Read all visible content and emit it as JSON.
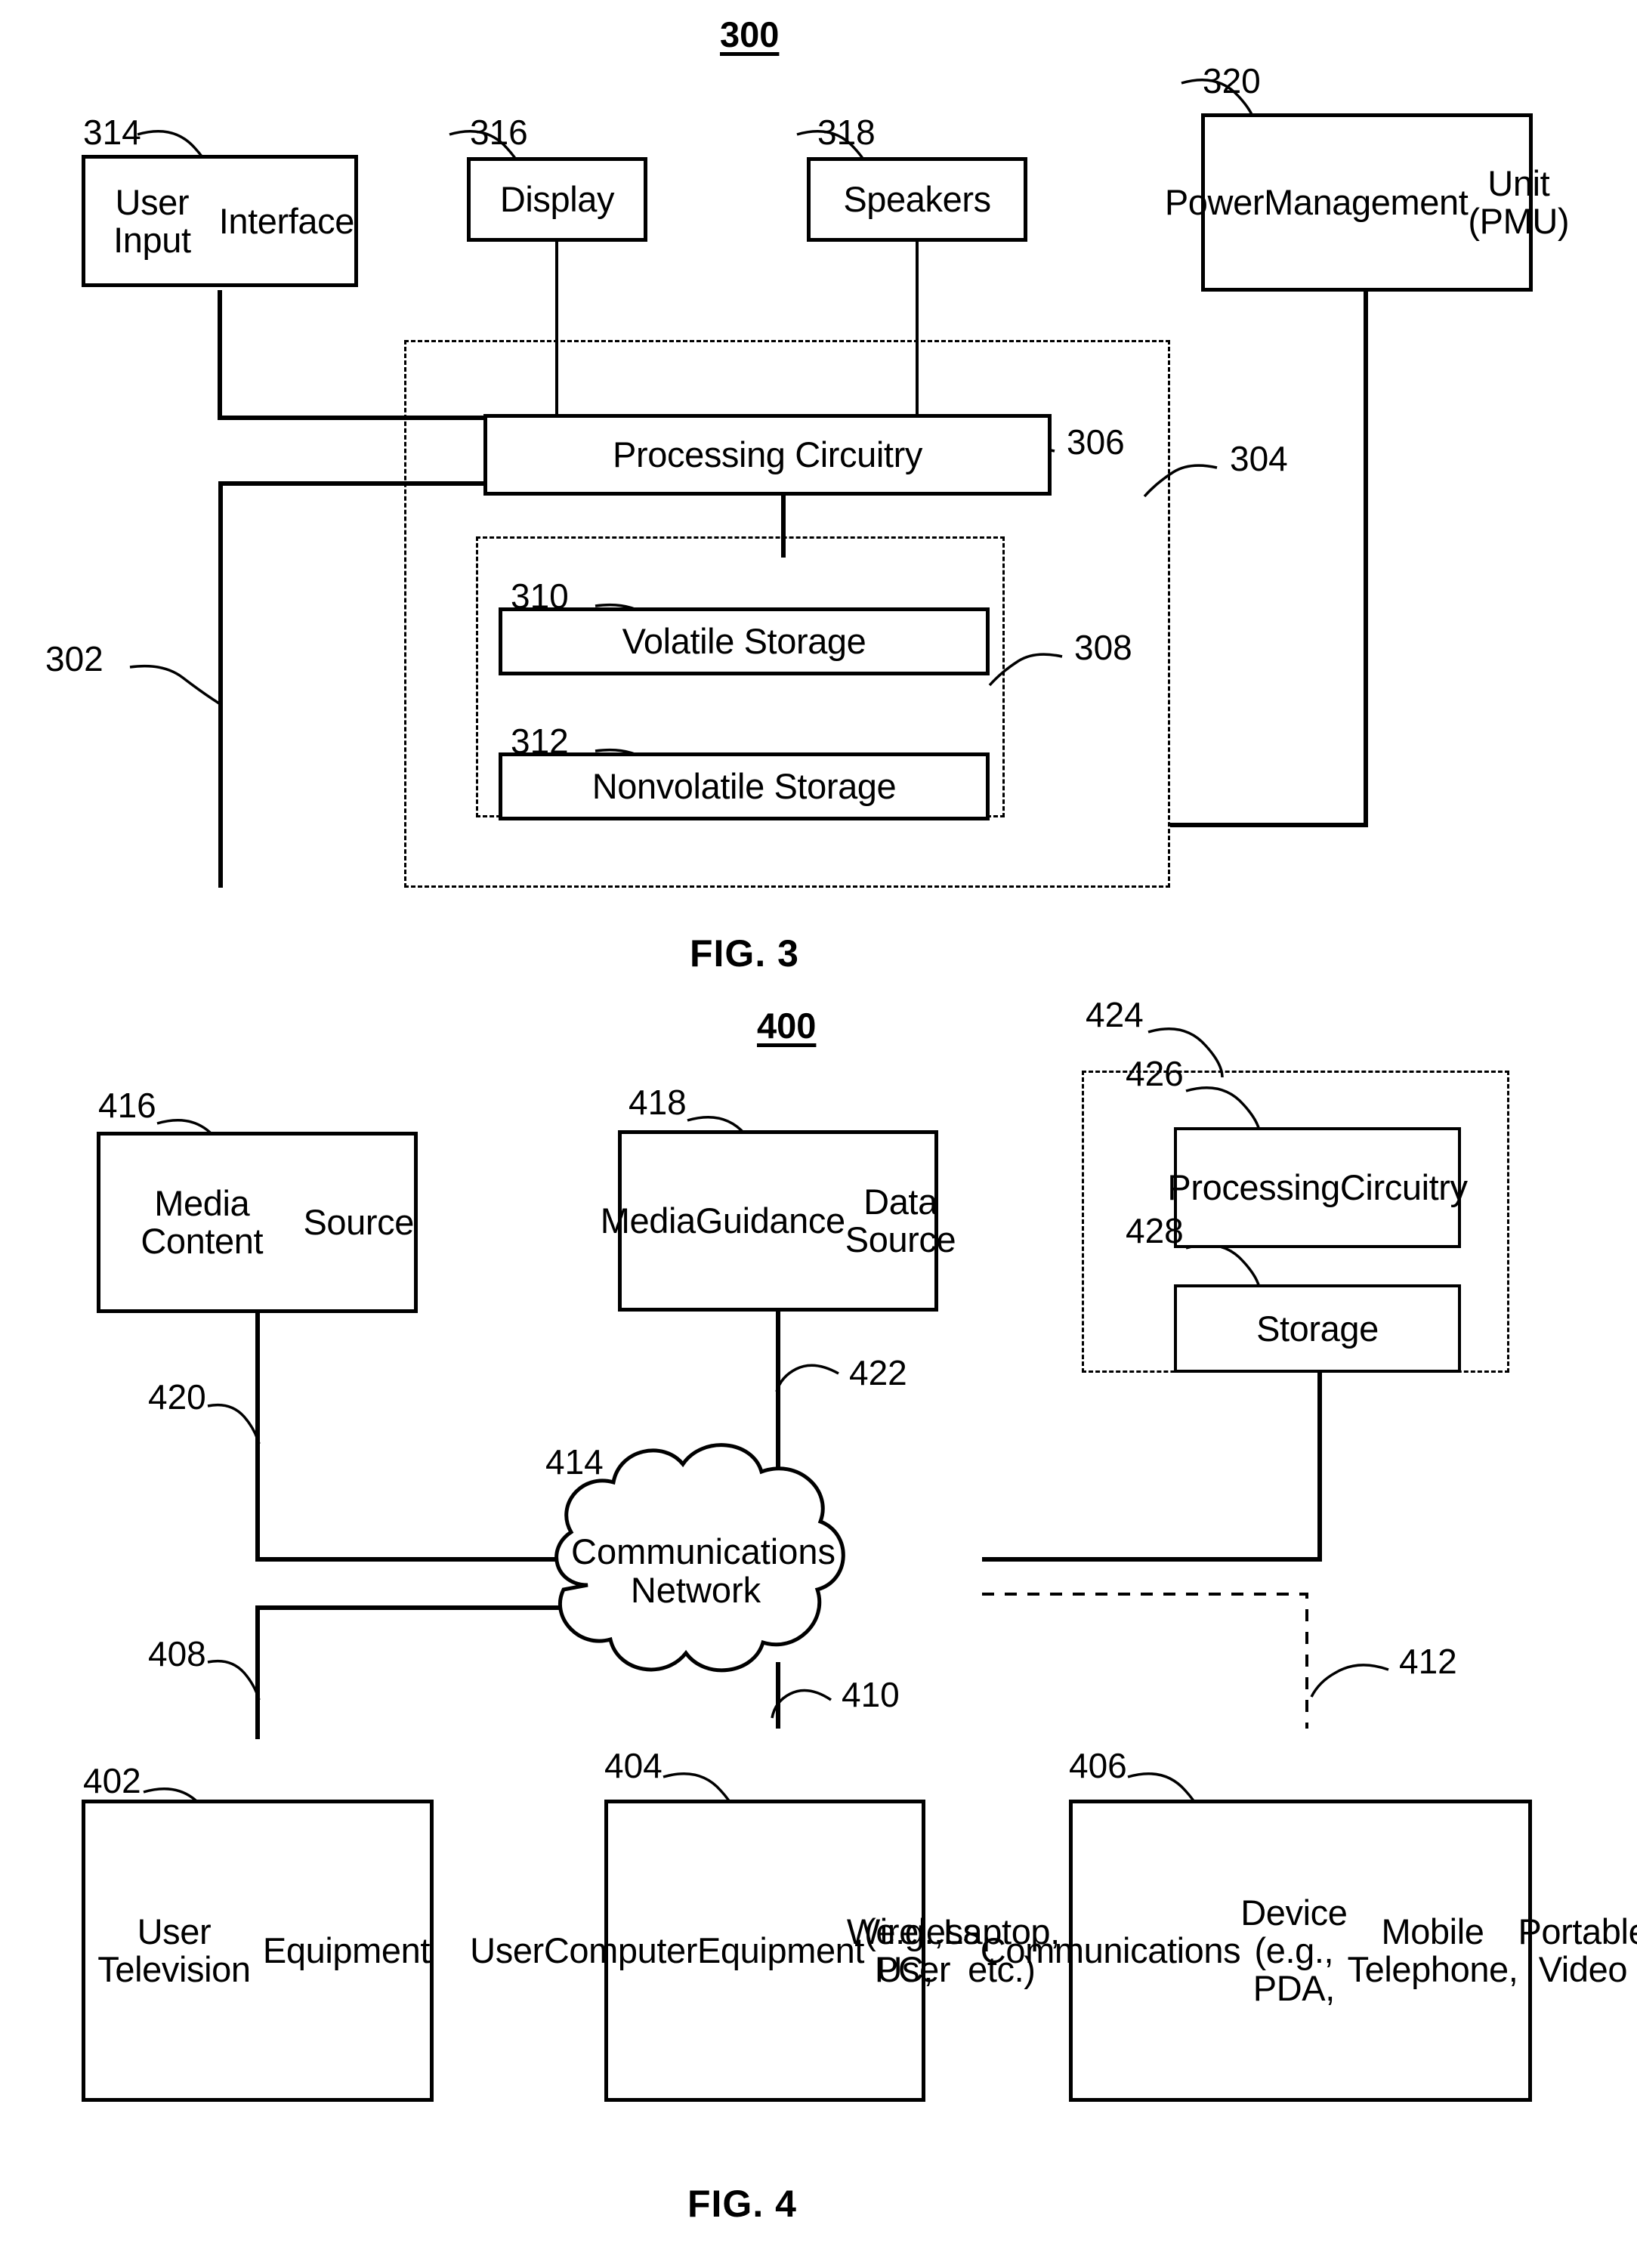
{
  "figures": [
    {
      "id": "fig3",
      "number_label": "300",
      "caption": "FIG. 3",
      "blocks": [
        {
          "ref": "314",
          "label": "User Input\nInterface"
        },
        {
          "ref": "316",
          "label": "Display"
        },
        {
          "ref": "318",
          "label": "Speakers"
        },
        {
          "ref": "320",
          "label": "Power\nManagement\nUnit (PMU)"
        },
        {
          "ref": "306",
          "label": "Processing Circuitry"
        },
        {
          "ref": "310",
          "label": "Volatile Storage"
        },
        {
          "ref": "312",
          "label": "Nonvolatile Storage"
        }
      ],
      "callouts": [
        {
          "ref": "302",
          "describes": "bus-line"
        },
        {
          "ref": "304",
          "describes": "device-boundary"
        },
        {
          "ref": "308",
          "describes": "storage-group"
        }
      ]
    },
    {
      "id": "fig4",
      "number_label": "400",
      "caption": "FIG. 4",
      "blocks": [
        {
          "ref": "416",
          "label": "Media Content\nSource"
        },
        {
          "ref": "418",
          "label": "Media\nGuidance\nData Source"
        },
        {
          "ref": "426",
          "label": "Processing\nCircuitry"
        },
        {
          "ref": "428",
          "label": "Storage"
        },
        {
          "ref": "402",
          "label": "User Television\nEquipment"
        },
        {
          "ref": "404",
          "label": "User\nComputer\nEquipment\n(e.g., PC,\nLaptop, etc.)"
        },
        {
          "ref": "406",
          "label": "Wireless User\nCommunications\nDevice (e.g., PDA,\nMobile Telephone,\nPortable Video\nPlayer, etc.)"
        }
      ],
      "cloud": {
        "ref": "414",
        "label_line1": "Communications",
        "label_line2": "Network"
      },
      "callouts": [
        {
          "ref": "420",
          "describes": "media-content-source-link"
        },
        {
          "ref": "422",
          "describes": "media-guidance-data-source-link"
        },
        {
          "ref": "408",
          "describes": "user-television-equipment-link"
        },
        {
          "ref": "410",
          "describes": "user-computer-equipment-link"
        },
        {
          "ref": "412",
          "describes": "wireless-device-link"
        },
        {
          "ref": "424",
          "describes": "server-group-boundary"
        }
      ]
    }
  ],
  "text": {
    "fig3_num": "300",
    "fig3_cap": "FIG. 3",
    "fig4_num": "400",
    "fig4_cap": "FIG. 4",
    "r302": "302",
    "r304": "304",
    "r306": "306",
    "r308": "308",
    "r310": "310",
    "r312": "312",
    "r314": "314",
    "r316": "316",
    "r318": "318",
    "r320": "320",
    "r402": "402",
    "r404": "404",
    "r406": "406",
    "r408": "408",
    "r410": "410",
    "r412": "412",
    "r414": "414",
    "r416": "416",
    "r418": "418",
    "r420": "420",
    "r422": "422",
    "r424": "424",
    "r426": "426",
    "r428": "428",
    "b314": "User Input\nInterface",
    "b316": "Display",
    "b318": "Speakers",
    "b320": "Power\nManagement\nUnit (PMU)",
    "b306": "Processing Circuitry",
    "b310": "Volatile Storage",
    "b312": "Nonvolatile Storage",
    "b416": "Media Content\nSource",
    "b418": "Media\nGuidance\nData Source",
    "b426": "Processing\nCircuitry",
    "b428": "Storage",
    "b402": "User Television\nEquipment",
    "b404": "User\nComputer\nEquipment\n(e.g., PC,\nLaptop, etc.)",
    "b406": "Wireless User\nCommunications\nDevice (e.g., PDA,\nMobile Telephone,\nPortable Video\nPlayer, etc.)",
    "cloud_l1": "Communications",
    "cloud_l2": "Network"
  }
}
